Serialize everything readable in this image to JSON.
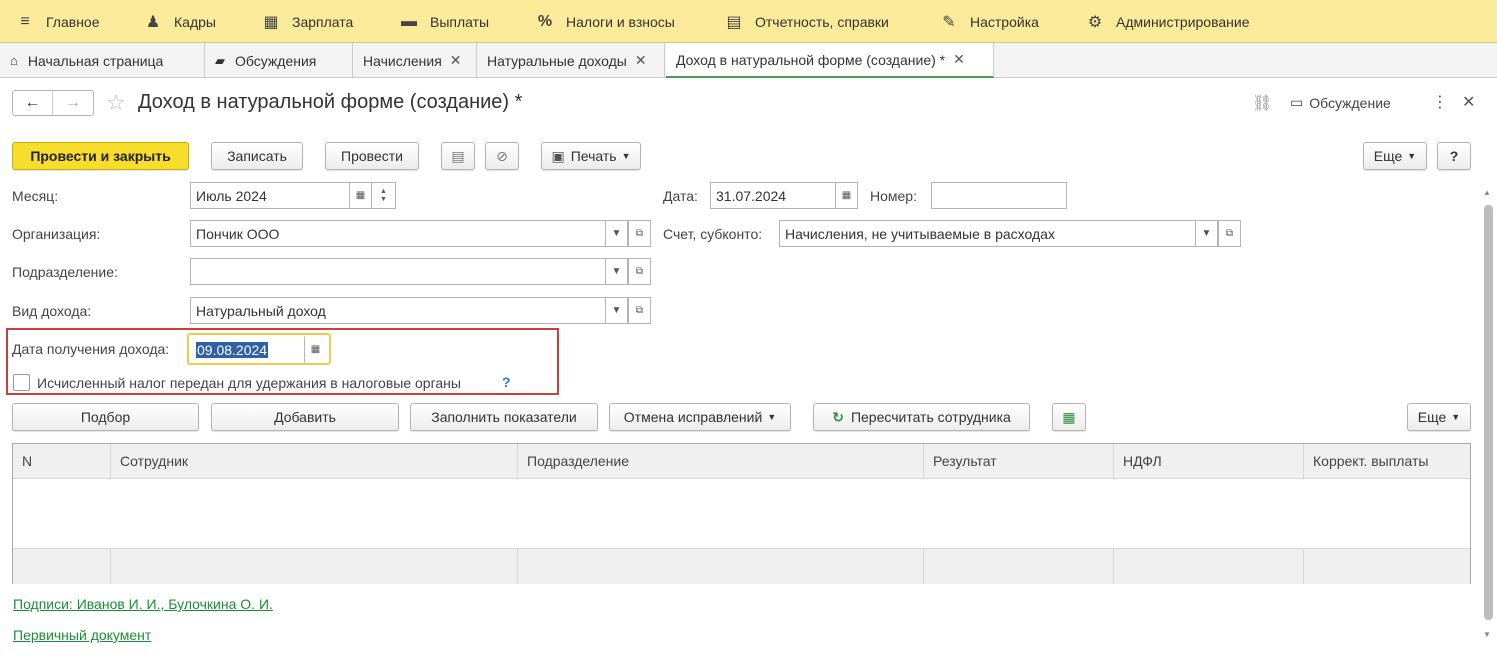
{
  "menu": [
    {
      "icon": "hamburger-icon",
      "glyph": "≡",
      "label": "Главное"
    },
    {
      "icon": "people-icon",
      "glyph": "👥",
      "label": "Кадры"
    },
    {
      "icon": "calculator-icon",
      "glyph": "▦",
      "label": "Зарплата"
    },
    {
      "icon": "wallet-icon",
      "glyph": "▬",
      "label": "Выплаты"
    },
    {
      "icon": "percent-icon",
      "glyph": "%",
      "label": "Налоги и взносы"
    },
    {
      "icon": "report-icon",
      "glyph": "▤",
      "label": "Отчетность, справки"
    },
    {
      "icon": "wrench-icon",
      "glyph": "🔧",
      "label": "Настройка"
    },
    {
      "icon": "gear-icon",
      "glyph": "⚙",
      "label": "Администрирование"
    }
  ],
  "tabs": [
    {
      "label": "Начальная страница"
    },
    {
      "label": "Обсуждения"
    },
    {
      "label": "Начисления"
    },
    {
      "label": "Натуральные доходы"
    },
    {
      "label": "Доход в натуральной форме (создание) *"
    }
  ],
  "form": {
    "title": "Доход в натуральной форме (создание) *",
    "discussion_label": "Обсуждение"
  },
  "toolbar": {
    "post_close": "Провести и закрыть",
    "save": "Записать",
    "post": "Провести",
    "print": "Печать",
    "more": "Еще",
    "help": "?"
  },
  "fields": {
    "month_label": "Месяц:",
    "month_value": "Июль 2024",
    "date_label": "Дата:",
    "date_value": "31.07.2024",
    "number_label": "Номер:",
    "number_value": "",
    "org_label": "Организация:",
    "org_value": "Пончик ООО",
    "account_label": "Счет, субконто:",
    "account_value": "Начисления, не учитываемые в расходах",
    "dept_label": "Подразделение:",
    "dept_value": "",
    "income_label": "Вид дохода:",
    "income_value": "Натуральный доход",
    "receipt_label": "Дата получения дохода:",
    "receipt_value": "09.08.2024",
    "tax_checkbox_label": "Исчисленный налог передан для удержания в налоговые органы",
    "tax_help": "?"
  },
  "table_toolbar": {
    "pick": "Подбор",
    "add": "Добавить",
    "fill": "Заполнить показатели",
    "cancel_fix": "Отмена исправлений",
    "recalc": "Пересчитать сотрудника",
    "more": "Еще"
  },
  "table": {
    "columns": [
      "N",
      "Сотрудник",
      "Подразделение",
      "Результат",
      "НДФЛ",
      "Коррект. выплаты"
    ],
    "rows": []
  },
  "links": {
    "signatures": "Подписи: Иванов И. И., Булочкина О. И.",
    "primary_doc": "Первичный документ"
  },
  "colors": {
    "menu_bg": "#fbeb9a",
    "accent_yellow": "#f7dd2c",
    "highlight_border": "#c9403a",
    "link_green": "#1c8c36"
  }
}
